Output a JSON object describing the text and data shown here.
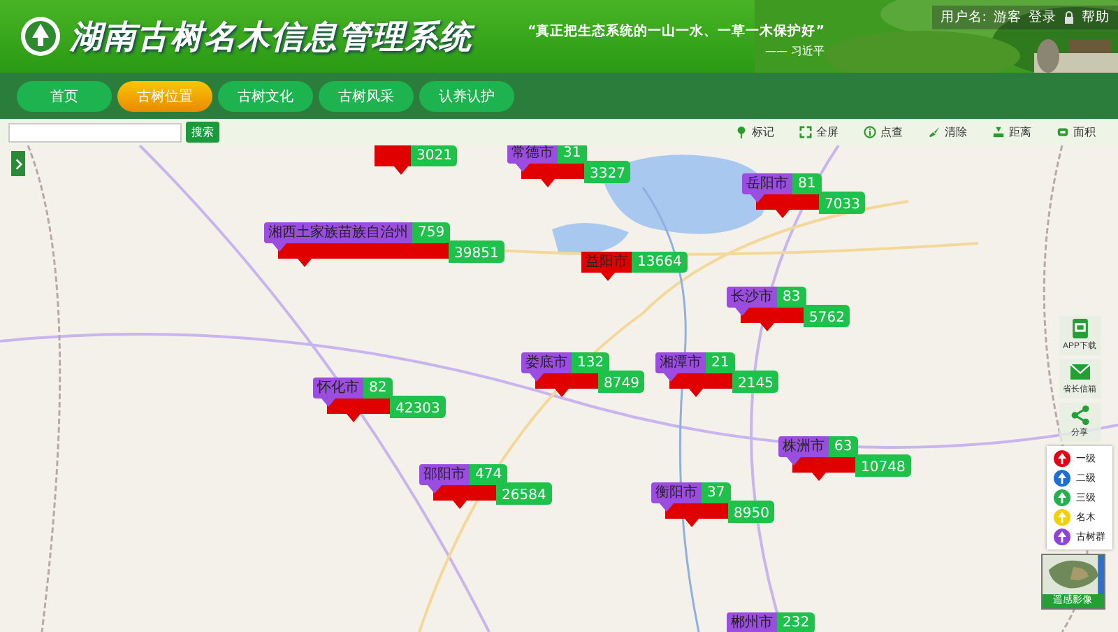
{
  "header": {
    "title": "湖南古树名木信息管理系统",
    "quote": "“真正把生态系统的一山一水、一草一木保护好”",
    "quote_author": "—— 习近平",
    "user_label": "用户名:",
    "user_name": "游客",
    "login": "登录",
    "help": "帮助"
  },
  "nav": [
    {
      "label": "首页",
      "selected": false
    },
    {
      "label": "古树位置",
      "selected": true
    },
    {
      "label": "古树文化",
      "selected": false
    },
    {
      "label": "古树风采",
      "selected": false
    },
    {
      "label": "认养认护",
      "selected": false
    }
  ],
  "search": {
    "button": "搜索"
  },
  "tools": [
    {
      "kind": "pin",
      "label": "标记"
    },
    {
      "kind": "fullscreen",
      "label": "全屏"
    },
    {
      "kind": "info",
      "label": "点查"
    },
    {
      "kind": "brush",
      "label": "清除"
    },
    {
      "kind": "ruler",
      "label": "距离"
    },
    {
      "kind": "area",
      "label": "面积"
    }
  ],
  "markers": [
    {
      "kind": "red",
      "site_count": "3021"
    },
    {
      "kind": "pair",
      "label": "常德市",
      "tree_count": "31",
      "site_count": "3327"
    },
    {
      "kind": "pair",
      "label": "岳阳市",
      "tree_count": "81",
      "site_count": "7033"
    },
    {
      "kind": "pair",
      "label": "湘西土家族苗族自治州",
      "tree_count": "759",
      "site_count": "39851"
    },
    {
      "kind": "red",
      "label": "益阳市",
      "site_count": "13664"
    },
    {
      "kind": "pair",
      "label": "长沙市",
      "tree_count": "83",
      "site_count": "5762"
    },
    {
      "kind": "pair",
      "label": "娄底市",
      "tree_count": "132",
      "site_count": "8749"
    },
    {
      "kind": "pair",
      "label": "湘潭市",
      "tree_count": "21",
      "site_count": "2145"
    },
    {
      "kind": "pair",
      "label": "怀化市",
      "tree_count": "82",
      "site_count": "42303"
    },
    {
      "kind": "pair",
      "label": "株洲市",
      "tree_count": "63",
      "site_count": "10748"
    },
    {
      "kind": "pair",
      "label": "邵阳市",
      "tree_count": "474",
      "site_count": "26584"
    },
    {
      "kind": "pair",
      "label": "衡阳市",
      "tree_count": "37",
      "site_count": "8950"
    },
    {
      "kind": "purple",
      "label": "郴州市",
      "tree_count": "232"
    }
  ],
  "side_buttons": [
    {
      "kind": "app",
      "label": "APP下载"
    },
    {
      "kind": "mail",
      "label": "省长信箱"
    },
    {
      "kind": "share",
      "label": "分享"
    }
  ],
  "legend": [
    {
      "label": "一级",
      "color": "#e60012"
    },
    {
      "label": "二级",
      "color": "#1a6fd6"
    },
    {
      "label": "三级",
      "color": "#22b14c"
    },
    {
      "label": "名木",
      "color": "#f5d000"
    },
    {
      "label": "古树群",
      "color": "#8e44d8"
    }
  ],
  "layer_switch": {
    "label": "遥感影像"
  }
}
